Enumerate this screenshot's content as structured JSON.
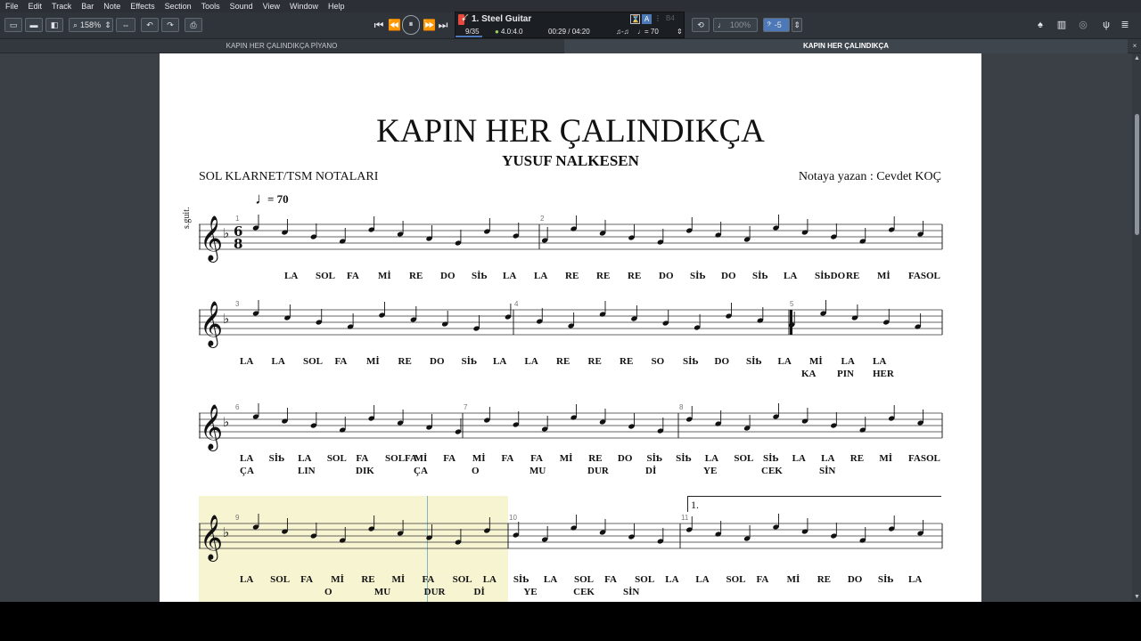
{
  "menu": [
    "File",
    "Edit",
    "Track",
    "Bar",
    "Note",
    "Effects",
    "Section",
    "Tools",
    "Sound",
    "View",
    "Window",
    "Help"
  ],
  "toolbar": {
    "zoom": "158%",
    "track_name": "1. Steel Guitar",
    "bar_position": "9/35",
    "time_signature": "4.0:4.0",
    "time": "00:29 / 04:20",
    "tempo": "♩= 70",
    "volume": "100%",
    "transpose": "-5"
  },
  "tabs": [
    "KAPIN HER ÇALINDIKÇA PİYANO",
    "KAPIN HER ÇALINDIKÇA"
  ],
  "score": {
    "title": "KAPIN HER ÇALINDIKÇA",
    "composer": "YUSUF NALKESEN",
    "left_header": "SOL KLARNET/TSM NOTALARI",
    "right_header": "Notaya yazan : Cevdet KOÇ",
    "tempo_value": "= 70",
    "track_label": "s.guit.",
    "volta": "1.",
    "bar_numbers": [
      "1",
      "2",
      "3",
      "4",
      "5",
      "6",
      "7",
      "8",
      "9",
      "10",
      "11"
    ],
    "lyrics": {
      "row1": [
        "LA",
        "SOL",
        "FA",
        "Mİ",
        "RE",
        "DO",
        "SİƄ",
        "LA",
        "LA",
        "RE",
        "RE",
        "RE",
        "DO",
        "SİƄ",
        "DO",
        "SİƄ",
        "LA",
        "SİƄDO",
        "RE",
        "Mİ",
        "FASOL"
      ],
      "row2": [
        "LA",
        "LA",
        "SOL",
        "FA",
        "Mİ",
        "RE",
        "DO",
        "SİƄ",
        "LA",
        "LA",
        "RE",
        "RE",
        "RE",
        "SO",
        "SİƄ",
        "DO",
        "SİƄ",
        "LA",
        "Mİ",
        "LA",
        "LA"
      ],
      "row2b": [
        "KA",
        "PIN",
        "HER"
      ],
      "row3": [
        "LA",
        "SİƄ",
        "LA",
        "SOL",
        "FA",
        "SOLFA",
        "Mİ",
        "FA",
        "Mİ",
        "FA",
        "FA",
        "Mİ",
        "RE",
        "DO",
        "SİƄ",
        "SİƄ",
        "LA",
        "SOL",
        "SİƄ",
        "LA",
        "LA",
        "RE",
        "Mİ",
        "FASOL"
      ],
      "row3b": [
        "ÇA",
        "LIN",
        "DIK",
        "ÇA",
        "O",
        "MU",
        "DUR",
        "Dİ",
        "YE",
        "CEK",
        "SİN"
      ],
      "row4": [
        "LA",
        "SOL",
        "FA",
        "Mİ",
        "RE",
        "Mİ",
        "FA",
        "SOL",
        "LA",
        "SİƄ",
        "LA",
        "SOL",
        "FA",
        "SOL",
        "LA",
        "LA",
        "SOL",
        "FA",
        "Mİ",
        "RE",
        "DO",
        "SİƄ",
        "LA"
      ],
      "row4b": [
        "O",
        "MU",
        "DUR",
        "Dİ",
        "YE",
        "CEK",
        "SİN"
      ]
    }
  },
  "colors": {
    "chrome_bg": "#3b4047",
    "selection_highlight": "#f7f5d1",
    "playback_cursor": "#7fb8c9"
  }
}
